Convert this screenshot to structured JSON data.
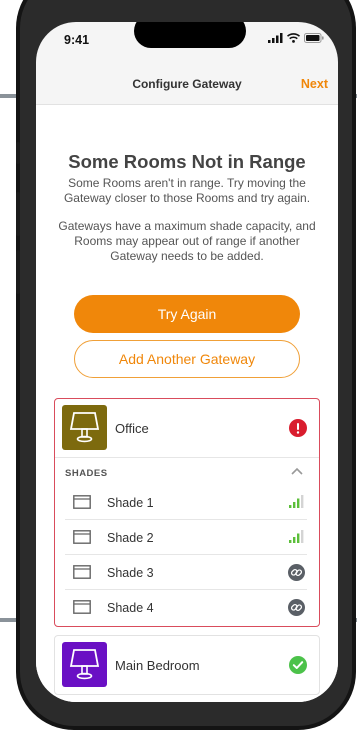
{
  "status_bar": {
    "time": "9:41",
    "icons": [
      "signal-icon",
      "wifi-icon",
      "battery-icon"
    ]
  },
  "nav": {
    "title": "Configure Gateway",
    "next_label": "Next"
  },
  "message": {
    "title": "Some Rooms Not in Range",
    "body": "Some Rooms aren't in range. Try moving the Gateway closer to those Rooms and try again.",
    "note": "Gateways have a maximum shade capacity, and Rooms may appear out of range if another Gateway needs to be added."
  },
  "actions": {
    "try_again_label": "Try Again",
    "add_gateway_label": "Add Another Gateway"
  },
  "rooms": [
    {
      "name": "Office",
      "icon": "lamp-icon",
      "icon_color": "#7d6a0e",
      "status": "error",
      "shades_label": "SHADES",
      "shades": [
        {
          "name": "Shade 1",
          "status": "signal-icon"
        },
        {
          "name": "Shade 2",
          "status": "signal-icon"
        },
        {
          "name": "Shade 3",
          "status": "link-icon"
        },
        {
          "name": "Shade 4",
          "status": "link-icon"
        }
      ]
    },
    {
      "name": "Main Bedroom",
      "icon": "lamp-icon",
      "icon_color": "#6a10c4",
      "status": "ok"
    }
  ],
  "colors": {
    "accent": "#f0870a",
    "error": "#d91d2e",
    "ok": "#4cc24a",
    "card_error_border": "#d94c5c"
  }
}
